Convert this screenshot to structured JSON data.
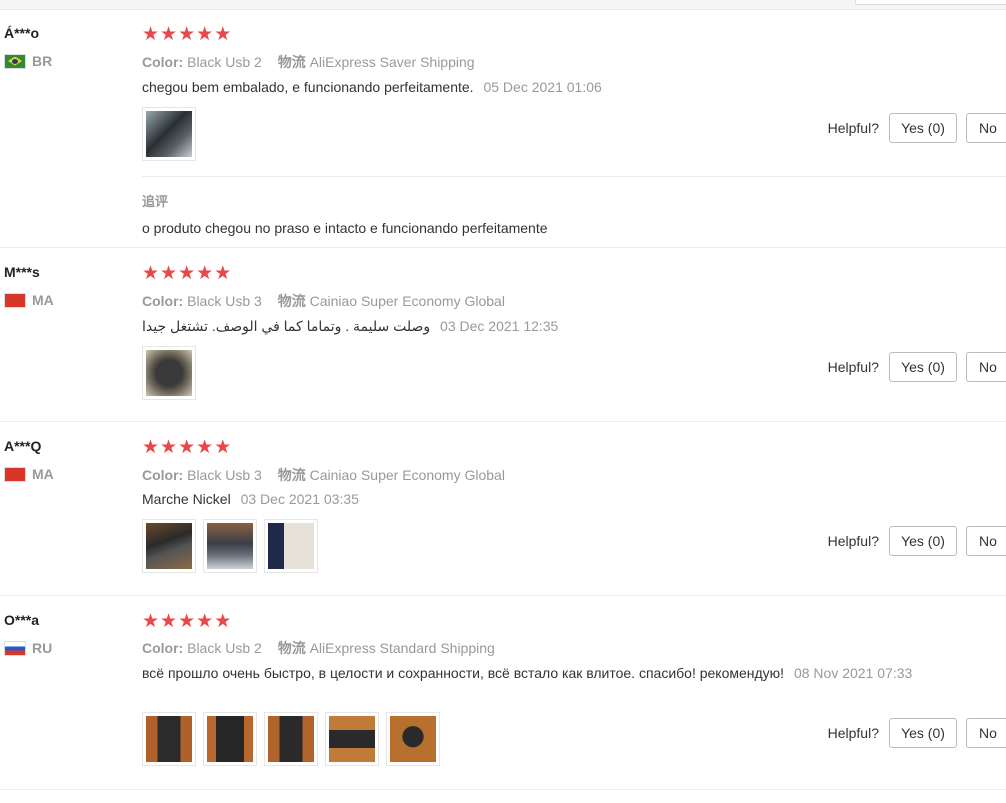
{
  "helpful_label": "Helpful?",
  "yes_label": "Yes (0)",
  "no_label": "No",
  "colors": {
    "star": "#e8484a",
    "muted": "#999999",
    "text": "#333333"
  },
  "reviews": [
    {
      "user": "Á***o",
      "country": "BR",
      "rating": 5,
      "color_label": "Color:",
      "color_value": "Black Usb 2",
      "shipping_label": "物流",
      "shipping_value": "AliExpress Saver Shipping",
      "text": "chegou bem embalado, e funcionando perfeitamente.",
      "date": "05 Dec 2021 01:06",
      "photos": 1,
      "followup_label": "追评",
      "followup_text": "o produto chegou no praso e intacto e funcionando perfeitamente"
    },
    {
      "user": "M***s",
      "country": "MA",
      "rating": 5,
      "color_label": "Color:",
      "color_value": "Black Usb 3",
      "shipping_label": "物流",
      "shipping_value": "Cainiao Super Economy Global",
      "text": "وصلت سليمة . وتماما كما في الوصف. تشتغل جيدا",
      "date": "03 Dec 2021 12:35",
      "photos": 1
    },
    {
      "user": "A***Q",
      "country": "MA",
      "rating": 5,
      "color_label": "Color:",
      "color_value": "Black Usb 3",
      "shipping_label": "物流",
      "shipping_value": "Cainiao Super Economy Global",
      "text": "Marche Nickel",
      "date": "03 Dec 2021 03:35",
      "photos": 3
    },
    {
      "user": "O***a",
      "country": "RU",
      "rating": 5,
      "color_label": "Color:",
      "color_value": "Black Usb 2",
      "shipping_label": "物流",
      "shipping_value": "AliExpress Standard Shipping",
      "text": "всё прошло очень быстро, в целости и сохранности, всё встало как влитое. спасибо! рекомендую!",
      "date": "08 Nov 2021 07:33",
      "photos": 5
    }
  ]
}
